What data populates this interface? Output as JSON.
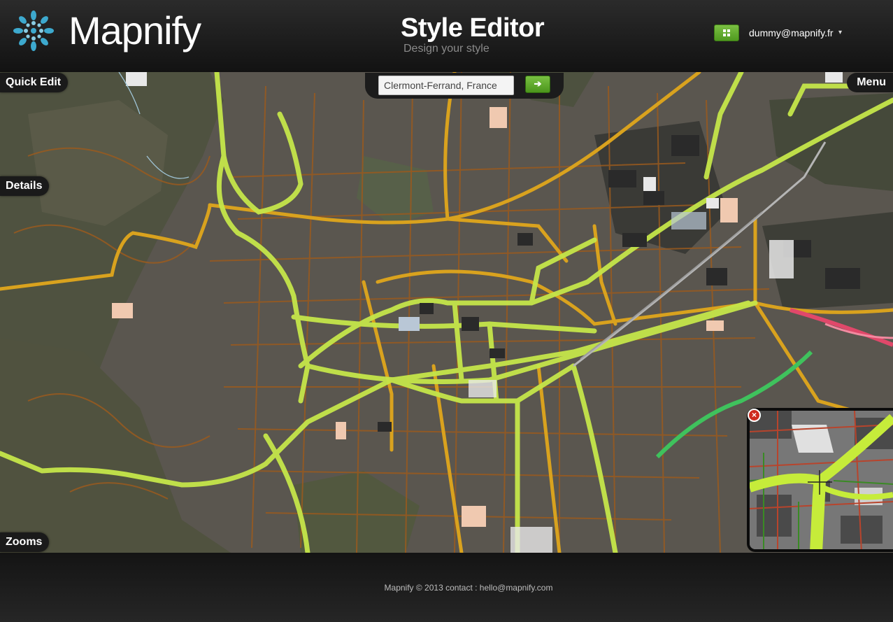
{
  "brand": {
    "name": "Mapnify",
    "logo_icon": "flower-logo-icon",
    "logo_color": "#3fb1d8"
  },
  "header": {
    "title": "Style Editor",
    "subtitle": "Design your style",
    "apps_icon": "grid-icon",
    "user_email": "dummy@mapnify.fr",
    "user_caret": "▾"
  },
  "panels": {
    "quick_edit": "Quick Edit",
    "details": "Details",
    "zooms": "Zooms",
    "menu": "Menu"
  },
  "search": {
    "value": "Clermont-Ferrand, France",
    "go_icon": "arrow-right-icon",
    "go_label": "➔"
  },
  "inset": {
    "close_icon": "close-icon",
    "close_label": "×",
    "crosshair_icon": "crosshair-icon"
  },
  "colors": {
    "accent_green": "#5aa827",
    "road_major": "#d9a21e",
    "road_highway": "#c5e64a",
    "road_minor": "#a4601c",
    "land": "#5a564f",
    "forest": "#4b4e3f"
  },
  "footer": {
    "text": "Mapnify © 2013 contact : hello@mapnify.com"
  }
}
